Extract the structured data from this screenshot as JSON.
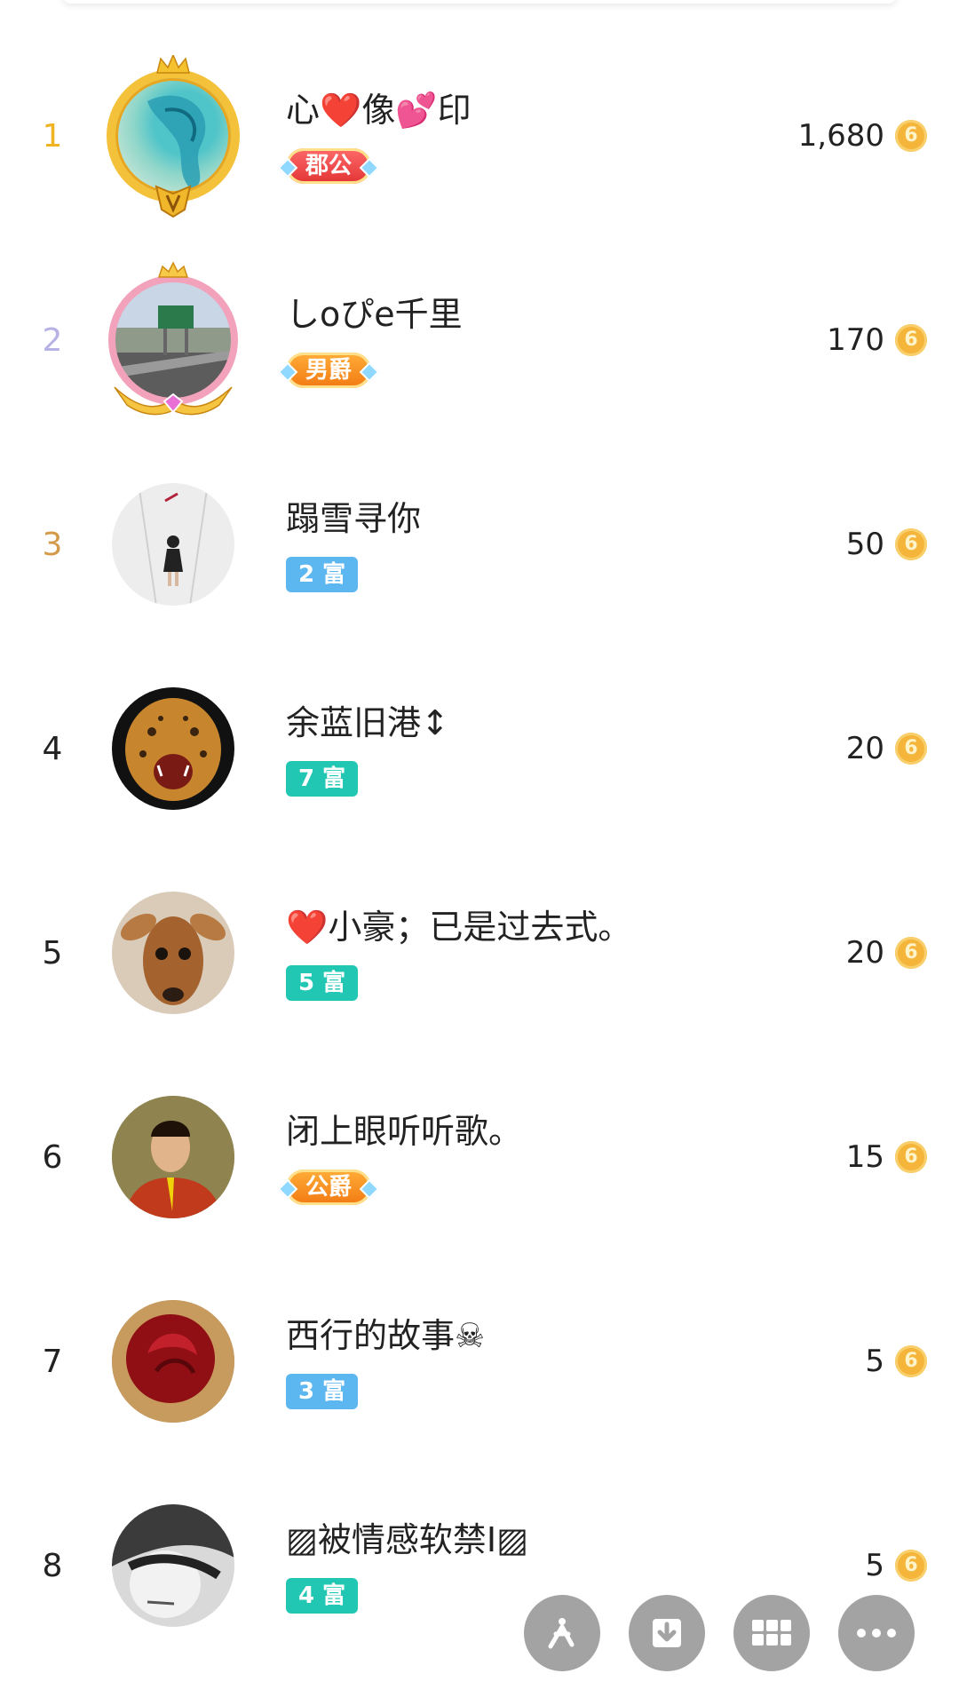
{
  "ranking": {
    "rows": [
      {
        "rank": "1",
        "rank_color": "#f0b324",
        "name": "心❤️像💕印",
        "badge": "郡公",
        "badge_style": "noble red",
        "amount": "1,680"
      },
      {
        "rank": "2",
        "rank_color": "#b7b2e6",
        "name": "しoぴe千里",
        "badge": "男爵",
        "badge_style": "noble orange",
        "amount": "170"
      },
      {
        "rank": "3",
        "rank_color": "#d39a4a",
        "name": "蹋雪寻你",
        "badge": "2 富",
        "badge_style": "rich-blue",
        "amount": "50"
      },
      {
        "rank": "4",
        "rank_color": "#222222",
        "name": "余蓝旧港↕",
        "badge": "7 富",
        "badge_style": "rich-teal",
        "amount": "20"
      },
      {
        "rank": "5",
        "rank_color": "#222222",
        "name": "❤️小豪；已是过去式。",
        "badge": "5 富",
        "badge_style": "rich-teal",
        "amount": "20"
      },
      {
        "rank": "6",
        "rank_color": "#222222",
        "name": "闭上眼听听歌。",
        "badge": "公爵",
        "badge_style": "noble orange",
        "amount": "15"
      },
      {
        "rank": "7",
        "rank_color": "#222222",
        "name": "西行的故事☠",
        "badge": "3 富",
        "badge_style": "rich-blue",
        "amount": "5"
      },
      {
        "rank": "8",
        "rank_color": "#222222",
        "name": "▨被情感软禁I▨",
        "badge": "4 富",
        "badge_style": "rich-teal",
        "amount": "5"
      }
    ],
    "coin_glyph": "6",
    "coin_icon": "gold-coin-icon"
  },
  "floating_actions": [
    {
      "name": "share-icon"
    },
    {
      "name": "download-icon"
    },
    {
      "name": "grid-icon"
    },
    {
      "name": "more-icon"
    }
  ],
  "colors": {
    "coin": "#f4b53a",
    "fab": "#a3a3a3",
    "rich_blue": "#5cb6ef",
    "rich_teal": "#22c7b3"
  }
}
